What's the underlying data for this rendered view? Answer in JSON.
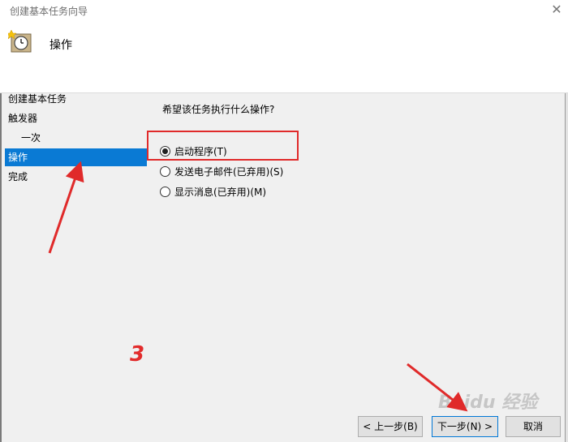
{
  "window": {
    "title": "创建基本任务向导",
    "close_glyph": "✕"
  },
  "header": {
    "heading": "操作"
  },
  "steps": [
    {
      "label": "创建基本任务",
      "active": false
    },
    {
      "label": "触发器",
      "active": false
    },
    {
      "label": "一次",
      "active": false,
      "indent": true
    },
    {
      "label": "操作",
      "active": true
    },
    {
      "label": "完成",
      "active": false
    }
  ],
  "question": "希望该任务执行什么操作?",
  "options": [
    {
      "label": "启动程序(T)",
      "checked": true
    },
    {
      "label": "发送电子邮件(已弃用)(S)",
      "checked": false
    },
    {
      "label": "显示消息(已弃用)(M)",
      "checked": false
    }
  ],
  "buttons": {
    "back": "< 上一步(B)",
    "next": "下一步(N) >",
    "cancel": "取消"
  },
  "annotation": {
    "number": "3"
  },
  "watermark": "Baidu 经验",
  "colors": {
    "accent": "#0a7ad4",
    "annotation_red": "#e02a2a"
  }
}
